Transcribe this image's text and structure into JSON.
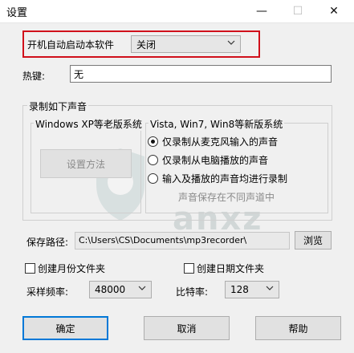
{
  "window": {
    "title": "设置",
    "minimize_glyph": "—",
    "maximize_glyph": "☐",
    "close_glyph": "✕"
  },
  "autostart": {
    "label": "开机自动启动本软件",
    "value": "关闭",
    "highlight_color": "#d0101b"
  },
  "hotkey": {
    "label": "热键:",
    "value": "无"
  },
  "recording": {
    "group_title": "录制如下声音",
    "xp": {
      "title": "Windows XP等老版系统",
      "setup_button": "设置方法"
    },
    "vista": {
      "title": "Vista, Win7, Win8等新版系统",
      "options": [
        {
          "label": "仅录制从麦克风输入的声音",
          "checked": true
        },
        {
          "label": "仅录制从电脑播放的声音",
          "checked": false
        },
        {
          "label": "输入及播放的声音均进行录制",
          "checked": false
        }
      ],
      "note": "声音保存在不同声道中"
    }
  },
  "save_path": {
    "label": "保存路径:",
    "value": "C:\\Users\\CS\\Documents\\mp3recorder\\",
    "browse_label": "浏览"
  },
  "folders": {
    "monthly_label": "创建月份文件夹",
    "monthly_checked": false,
    "daily_label": "创建日期文件夹",
    "daily_checked": false
  },
  "audio": {
    "samplerate_label": "采样频率:",
    "samplerate_value": "48000",
    "bitrate_label": "比特率:",
    "bitrate_value": "128"
  },
  "buttons": {
    "ok": "确定",
    "cancel": "取消",
    "help": "帮助"
  },
  "watermark": {
    "text": "anxz"
  },
  "colors": {
    "focus_accent": "#0078d7"
  }
}
